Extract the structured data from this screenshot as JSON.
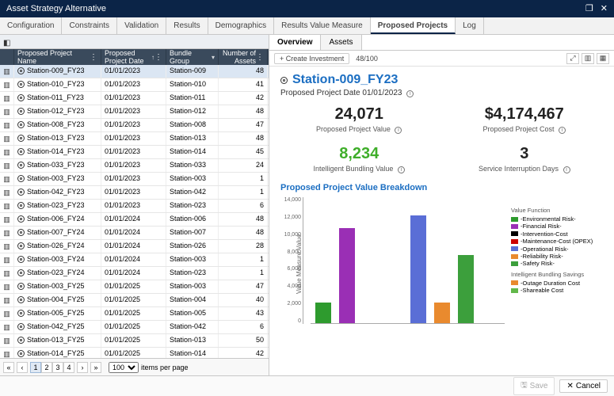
{
  "titlebar": {
    "title": "Asset Strategy Alternative"
  },
  "tabs": [
    {
      "label": "Configuration"
    },
    {
      "label": "Constraints"
    },
    {
      "label": "Validation"
    },
    {
      "label": "Results"
    },
    {
      "label": "Demographics"
    },
    {
      "label": "Results Value Measure"
    },
    {
      "label": "Proposed Projects"
    },
    {
      "label": "Log"
    }
  ],
  "active_tab": 6,
  "grid": {
    "columns": [
      "",
      "Proposed Project Name",
      "Proposed Project Date",
      "Bundle Group",
      "Number of Assets"
    ],
    "rows": [
      {
        "name": "Station-009_FY23",
        "date": "01/01/2023",
        "bundle": "Station-009",
        "assets": 48,
        "sel": true
      },
      {
        "name": "Station-010_FY23",
        "date": "01/01/2023",
        "bundle": "Station-010",
        "assets": 41
      },
      {
        "name": "Station-011_FY23",
        "date": "01/01/2023",
        "bundle": "Station-011",
        "assets": 42
      },
      {
        "name": "Station-012_FY23",
        "date": "01/01/2023",
        "bundle": "Station-012",
        "assets": 48
      },
      {
        "name": "Station-008_FY23",
        "date": "01/01/2023",
        "bundle": "Station-008",
        "assets": 47
      },
      {
        "name": "Station-013_FY23",
        "date": "01/01/2023",
        "bundle": "Station-013",
        "assets": 48
      },
      {
        "name": "Station-014_FY23",
        "date": "01/01/2023",
        "bundle": "Station-014",
        "assets": 45
      },
      {
        "name": "Station-033_FY23",
        "date": "01/01/2023",
        "bundle": "Station-033",
        "assets": 24
      },
      {
        "name": "Station-003_FY23",
        "date": "01/01/2023",
        "bundle": "Station-003",
        "assets": 1
      },
      {
        "name": "Station-042_FY23",
        "date": "01/01/2023",
        "bundle": "Station-042",
        "assets": 1
      },
      {
        "name": "Station-023_FY23",
        "date": "01/01/2023",
        "bundle": "Station-023",
        "assets": 6
      },
      {
        "name": "Station-006_FY24",
        "date": "01/01/2024",
        "bundle": "Station-006",
        "assets": 48
      },
      {
        "name": "Station-007_FY24",
        "date": "01/01/2024",
        "bundle": "Station-007",
        "assets": 48
      },
      {
        "name": "Station-026_FY24",
        "date": "01/01/2024",
        "bundle": "Station-026",
        "assets": 28
      },
      {
        "name": "Station-003_FY24",
        "date": "01/01/2024",
        "bundle": "Station-003",
        "assets": 1
      },
      {
        "name": "Station-023_FY24",
        "date": "01/01/2024",
        "bundle": "Station-023",
        "assets": 1
      },
      {
        "name": "Station-003_FY25",
        "date": "01/01/2025",
        "bundle": "Station-003",
        "assets": 47
      },
      {
        "name": "Station-004_FY25",
        "date": "01/01/2025",
        "bundle": "Station-004",
        "assets": 40
      },
      {
        "name": "Station-005_FY25",
        "date": "01/01/2025",
        "bundle": "Station-005",
        "assets": 43
      },
      {
        "name": "Station-042_FY25",
        "date": "01/01/2025",
        "bundle": "Station-042",
        "assets": 6
      },
      {
        "name": "Station-013_FY25",
        "date": "01/01/2025",
        "bundle": "Station-013",
        "assets": 50
      },
      {
        "name": "Station-014_FY25",
        "date": "01/01/2025",
        "bundle": "Station-014",
        "assets": 42
      }
    ]
  },
  "pager": {
    "pages": [
      "1",
      "2",
      "3",
      "4"
    ],
    "active_page": 0,
    "page_size": "100",
    "label_suffix": "items per page"
  },
  "subtabs": [
    {
      "label": "Overview"
    },
    {
      "label": "Assets"
    }
  ],
  "active_subtab": 0,
  "proj_toolbar": {
    "create_label": "+ Create Investment",
    "counter": "48/100"
  },
  "project": {
    "title": "Station-009_FY23",
    "subtext": "Proposed Project Date 01/01/2023",
    "metrics": [
      {
        "value": "24,071",
        "label": "Proposed Project Value",
        "cls": ""
      },
      {
        "value": "$4,174,467",
        "label": "Proposed Project Cost",
        "cls": ""
      },
      {
        "value": "8,234",
        "label": "Intelligent Bundling Value",
        "cls": "green"
      },
      {
        "value": "3",
        "label": "Service Interruption Days",
        "cls": ""
      }
    ]
  },
  "chart_title": "Proposed Project Value Breakdown",
  "chart_data": {
    "type": "bar",
    "ylabel": "Value Measure Value",
    "ylim": [
      0,
      14000
    ],
    "yticks": [
      "0",
      "2,000",
      "4,000",
      "6,000",
      "8,000",
      "10,000",
      "12,000",
      "14,000"
    ],
    "series": [
      {
        "name": "Environmental Risk-",
        "color": "#2e9b2e",
        "value": 2300
      },
      {
        "name": "Financial Risk-",
        "color": "#9a2fb5",
        "value": 10600
      },
      {
        "name": "Intervention-Cost",
        "color": "#000000",
        "value": 0
      },
      {
        "name": "Maintenance-Cost (OPEX)",
        "color": "#cc0000",
        "value": 0
      },
      {
        "name": "Operational Risk-",
        "color": "#5a6ed6",
        "value": 12000
      },
      {
        "name": "Reliability Risk-",
        "color": "#e98a2e",
        "value": 2300
      },
      {
        "name": "Safety Risk-",
        "color": "#3c9f3c",
        "value": 7600
      }
    ],
    "bundling_legend": [
      {
        "name": "Outage Duration Cost",
        "color": "#e98a2e"
      },
      {
        "name": "Shareable Cost",
        "color": "#62b84a"
      }
    ],
    "legend_headers": [
      "Value Function",
      "Intelligent Bundling Savings"
    ]
  },
  "footer": {
    "save": "Save",
    "cancel": "Cancel"
  }
}
